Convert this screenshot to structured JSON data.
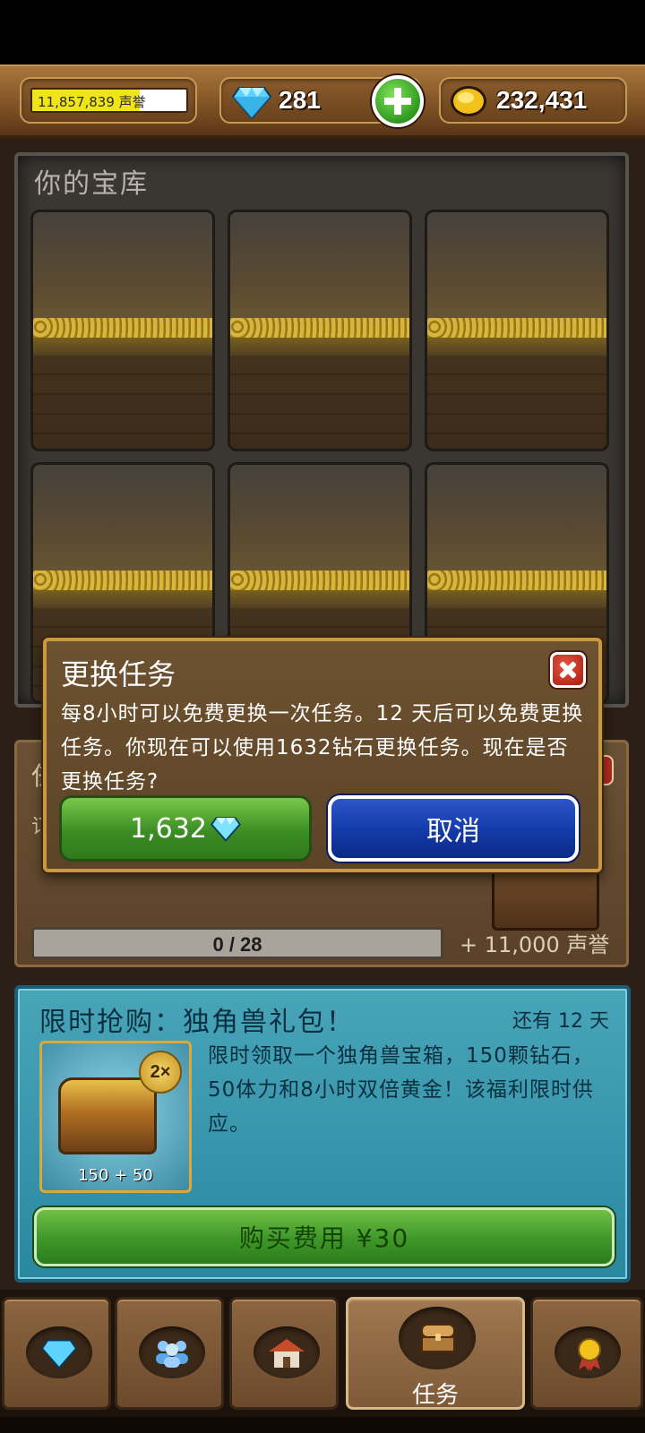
{
  "header": {
    "reputation_text": "11,857,839 声誉",
    "reputation_progress": 0.7,
    "gems": "281",
    "gold": "232,431"
  },
  "vault": {
    "title": "你的宝库",
    "slots": 6
  },
  "mission_panel": {
    "title_fragment": "任",
    "desc_fragment": "订",
    "progress": "0 / 28",
    "reward": "+ 11,000 声誉"
  },
  "dialog": {
    "title": "更换任务",
    "message": "每8小时可以免费更换一次任务。12 天后可以免费更换任务。你现在可以使用1632钻石更换任务。现在是否更换任务?",
    "buy_label": "1,632",
    "cancel_label": "取消"
  },
  "sale": {
    "title": "限时抢购：独角兽礼包！",
    "time_left": "还有 12 天",
    "badge": "2×",
    "caption": "150 + 50",
    "description": "限时领取一个独角兽宝箱，150颗钻石，50体力和8小时双倍黄金！该福利限时供应。",
    "buy_label": "购买费用 ¥30"
  },
  "nav": {
    "active_label": "任务",
    "items": [
      "gem-icon",
      "people-icon",
      "house-icon",
      "chest-icon",
      "medal-icon"
    ]
  },
  "colors": {
    "accent_green": "#3c8d24",
    "accent_blue": "#123aa8",
    "teal_panel": "#2a87a0"
  }
}
